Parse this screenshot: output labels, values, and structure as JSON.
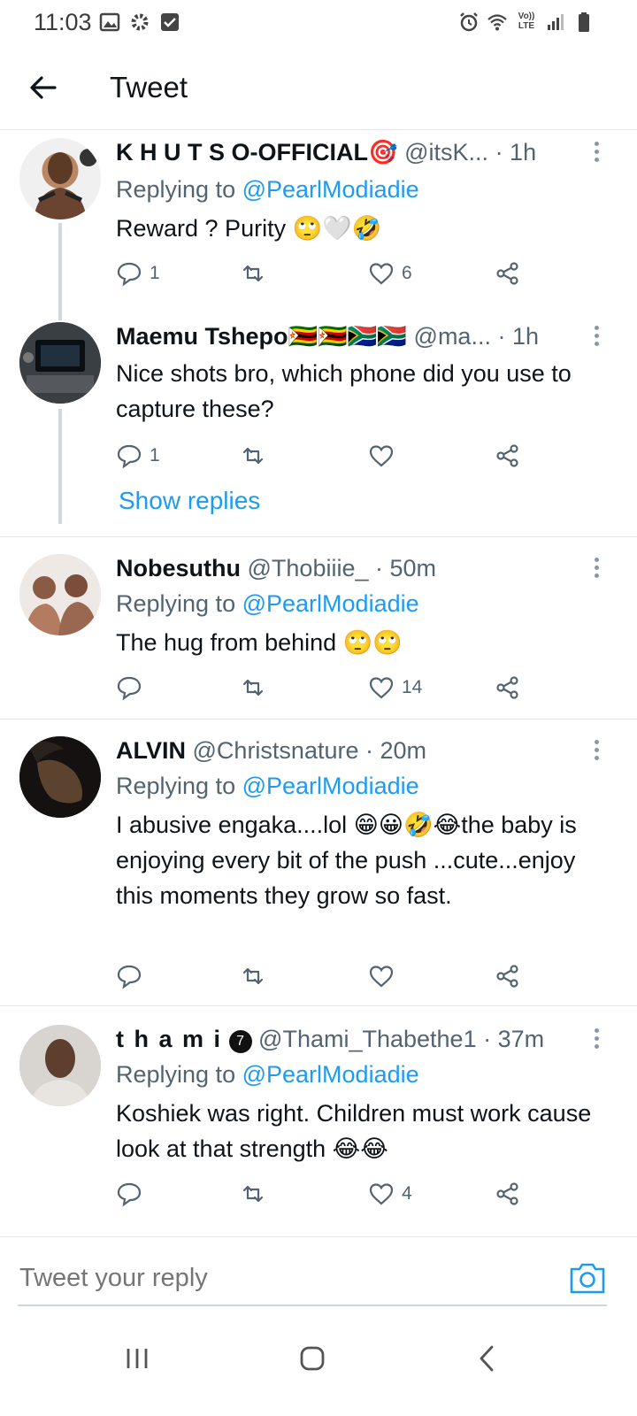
{
  "status_bar": {
    "time": "11:03",
    "left_icons": [
      "image-icon",
      "gear-icon",
      "checkbox-icon"
    ],
    "right_icons": [
      "alarm-icon",
      "wifi-icon",
      "volte-icon",
      "signal-icon",
      "battery-icon"
    ],
    "volte_label_top": "Vo))",
    "volte_label_bottom": "LTE"
  },
  "header": {
    "title": "Tweet"
  },
  "tweets": [
    {
      "name": "K H U T S O-OFFICIAL",
      "name_emoji": "🎯",
      "handle": "@itsK...",
      "time": "· 1h",
      "replying_label": "Replying to",
      "replying_to": "@PearlModiadie",
      "text": "Reward ? Purity",
      "emojis": [
        "🙄",
        "🤍",
        "🤣"
      ],
      "replies": "1",
      "retweets": "",
      "likes": "6"
    },
    {
      "name": "Maemu Tshepo",
      "name_emoji": "🇿🇼🇿🇼🇿🇦🇿🇦",
      "handle": "@ma...",
      "time": "· 1h",
      "text": "Nice shots bro, which phone did you use to capture these?",
      "emojis": [],
      "replies": "1",
      "retweets": "",
      "likes": "",
      "show_replies": "Show replies"
    },
    {
      "name": "Nobesuthu",
      "handle": "@Thobiiie_",
      "time": "· 50m",
      "replying_label": "Replying to",
      "replying_to": "@PearlModiadie",
      "text": "The hug from behind",
      "emojis": [
        "🙄",
        "🙄"
      ],
      "replies": "",
      "retweets": "",
      "likes": "14"
    },
    {
      "name": "ALVIN",
      "handle": "@Christsnature",
      "time": "· 20m",
      "replying_label": "Replying to",
      "replying_to": "@PearlModiadie",
      "text_a": "I abusive engaka....lol",
      "emojis": [
        "😁",
        "😀",
        "🤣",
        "😂"
      ],
      "text_b": "the baby is enjoying every bit of the push ...cute...enjoy this moments they grow so fast.",
      "replies": "",
      "retweets": "",
      "likes": ""
    },
    {
      "name": "t h a m i",
      "name_badge": "7",
      "handle": "@Thami_Thabethe1",
      "time": "· 37m",
      "replying_label": "Replying to",
      "replying_to": "@PearlModiadie",
      "text": "Koshiek was right. Children must work cause look at that strength",
      "emojis": [
        "😂",
        "😂"
      ],
      "replies": "",
      "retweets": "",
      "likes": "4"
    }
  ],
  "reply_bar": {
    "placeholder": "Tweet your reply"
  },
  "colors": {
    "accent": "#1d9bf0",
    "text": "#0f1419",
    "secondary": "#536471",
    "divider": "#e6e6e6"
  }
}
